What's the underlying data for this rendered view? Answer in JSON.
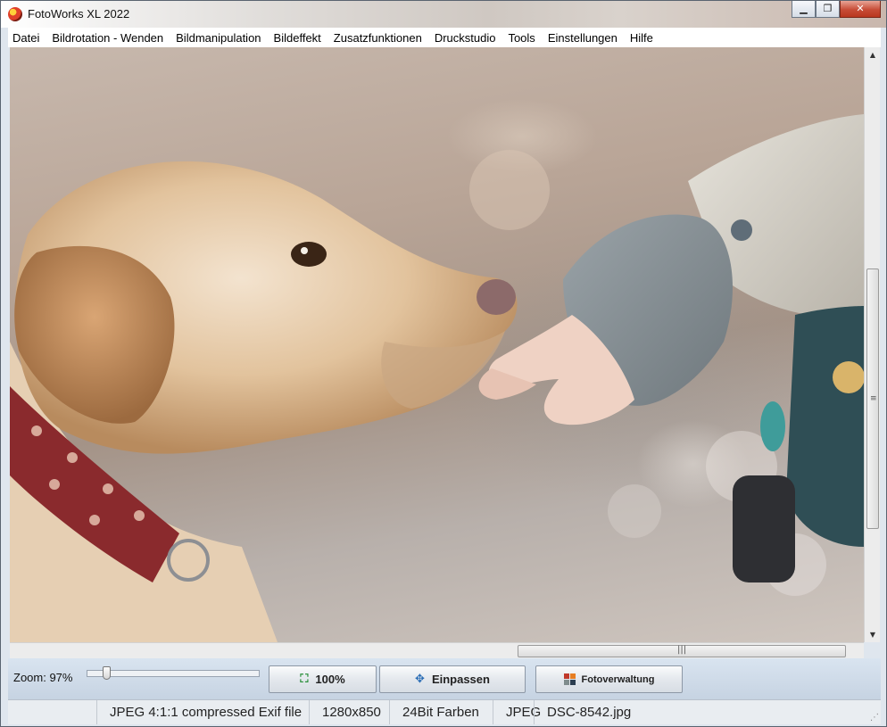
{
  "window": {
    "title": "FotoWorks XL 2022",
    "minimize": "▁",
    "maximize": "❐",
    "close": "✕"
  },
  "menu": {
    "items": [
      {
        "label": "Datei"
      },
      {
        "label": "Bildrotation - Wenden"
      },
      {
        "label": "Bildmanipulation"
      },
      {
        "label": "Bildeffekt"
      },
      {
        "label": "Zusatzfunktionen"
      },
      {
        "label": "Druckstudio"
      },
      {
        "label": "Tools"
      },
      {
        "label": "Einstellungen"
      },
      {
        "label": "Hilfe"
      }
    ]
  },
  "image": {
    "description_icon": "photo-dog-and-hand"
  },
  "scrollbars": {
    "vertical_grip": "≡",
    "horizontal_grip": "|||",
    "up_arrow": "▲",
    "down_arrow": "▼",
    "left_arrow": "◀",
    "right_arrow": "▶"
  },
  "controls": {
    "zoom_label": "Zoom: 97%",
    "zoom_value": 97,
    "btn_100": "100%",
    "btn_fit": "Einpassen",
    "btn_fotoverwaltung": "Fotoverwaltung"
  },
  "status": {
    "file_type": "JPEG 4:1:1 compressed Exif file",
    "resolution": "1280x850",
    "colors": "24Bit Farben",
    "format": "JPEG",
    "filename": "DSC-8542.jpg"
  },
  "colors": {
    "accent_blue": "#2a6db5",
    "close_red": "#c74c36"
  }
}
